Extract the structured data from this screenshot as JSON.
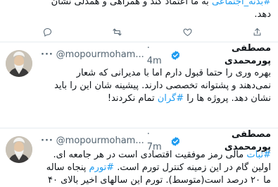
{
  "tweet_top": {
    "line1_hashtag": "#بدنه_اجتماعی",
    "line1_text": " به ما اعتماد کند و همراهی و همدلی نشان",
    "line2": "دهد."
  },
  "tweet_1": {
    "display_name": "مصطفی پورمحمدی",
    "handle": "@mopourmoham...",
    "time": "· 4m",
    "lines": [
      "بهره وری را حتما قبول دارم اما با مدیرانی که شعار",
      "نمی‌دهند و پشتوانه تخصصی دارند. پیشینه شان این را باید"
    ],
    "line3_a": "نشان دهد. پروژه ها را ",
    "line3_hashtag": "#گران",
    "line3_b": " تمام نکردند!"
  },
  "tweet_2": {
    "display_name": "مصطفی پورمحمدی",
    "handle": "@mopourmoham...",
    "time": "· 7m",
    "line1_hashtag": "#ثبات",
    "line1_text": " مالی رمز موفقیت اقتصادی است در هر جامعه ای.",
    "line2_a": "اولین گام در این زمینه کنترل تورم است. ",
    "line2_hashtag": "#تورم",
    "line2_b": " پنجاه ساله",
    "line3": "ما ۲۰ درصد است(متوسط). تورم این سالهای اخیر بالای ۴۰"
  },
  "colors": {
    "accent": "#1d9bf0",
    "verified": "#1d9bf0",
    "muted": "#536471"
  },
  "icons": {
    "reply": "reply-icon",
    "retweet": "retweet-icon",
    "like": "heart-icon",
    "share": "share-icon"
  }
}
